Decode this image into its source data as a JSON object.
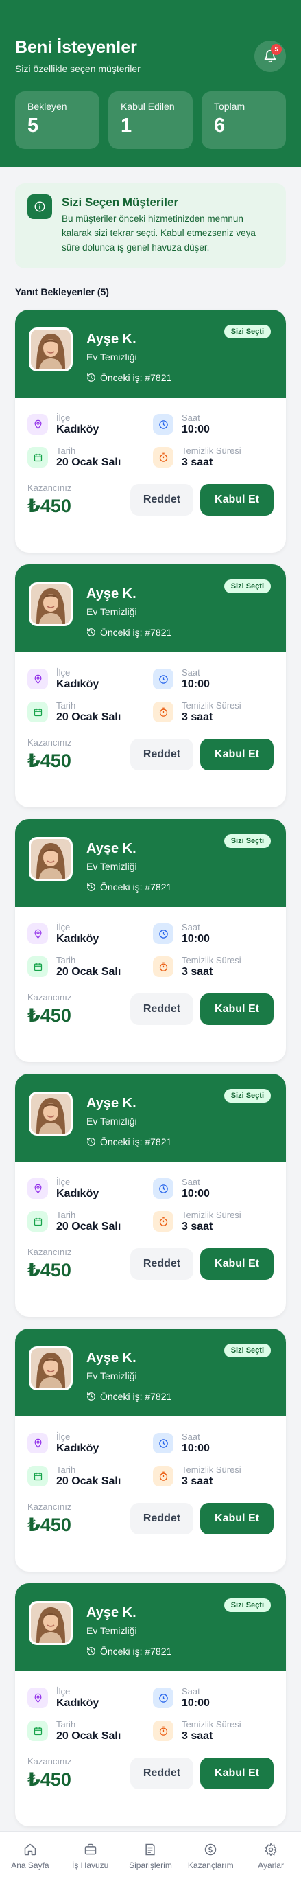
{
  "header": {
    "title": "Beni İsteyenler",
    "subtitle": "Sizi özellikle seçen müşteriler",
    "notification_count": "5",
    "stats": [
      {
        "label": "Bekleyen",
        "value": "5"
      },
      {
        "label": "Kabul Edilen",
        "value": "1"
      },
      {
        "label": "Toplam",
        "value": "6"
      }
    ]
  },
  "info": {
    "title": "Sizi Seçen Müşteriler",
    "text": "Bu müşteriler önceki hizmetinizden memnun kalarak sizi tekrar seçti. Kabul etmezseniz veya süre dolunca iş genel havuza düşer."
  },
  "section_title": "Yanıt Bekleyenler (5)",
  "labels": {
    "district": "İlçe",
    "time": "Saat",
    "date": "Tarih",
    "duration": "Temizlik Süresi",
    "earnings": "Kazancınız",
    "reject": "Reddet",
    "accept": "Kabul Et",
    "badge": "Sizi Seçti"
  },
  "requests": [
    {
      "name": "Ayşe K.",
      "service": "Ev Temizliği",
      "previous_job": "Önceki iş: #7821",
      "district": "Kadıköy",
      "time": "10:00",
      "date": "20 Ocak Salı",
      "duration": "3 saat",
      "earnings": "₺450"
    },
    {
      "name": "Ayşe K.",
      "service": "Ev Temizliği",
      "previous_job": "Önceki iş: #7821",
      "district": "Kadıköy",
      "time": "10:00",
      "date": "20 Ocak Salı",
      "duration": "3 saat",
      "earnings": "₺450"
    },
    {
      "name": "Ayşe K.",
      "service": "Ev Temizliği",
      "previous_job": "Önceki iş: #7821",
      "district": "Kadıköy",
      "time": "10:00",
      "date": "20 Ocak Salı",
      "duration": "3 saat",
      "earnings": "₺450"
    },
    {
      "name": "Ayşe K.",
      "service": "Ev Temizliği",
      "previous_job": "Önceki iş: #7821",
      "district": "Kadıköy",
      "time": "10:00",
      "date": "20 Ocak Salı",
      "duration": "3 saat",
      "earnings": "₺450"
    },
    {
      "name": "Ayşe K.",
      "service": "Ev Temizliği",
      "previous_job": "Önceki iş: #7821",
      "district": "Kadıköy",
      "time": "10:00",
      "date": "20 Ocak Salı",
      "duration": "3 saat",
      "earnings": "₺450"
    },
    {
      "name": "Ayşe K.",
      "service": "Ev Temizliği",
      "previous_job": "Önceki iş: #7821",
      "district": "Kadıköy",
      "time": "10:00",
      "date": "20 Ocak Salı",
      "duration": "3 saat",
      "earnings": "₺450"
    }
  ],
  "nav": [
    {
      "label": "Ana Sayfa",
      "icon": "home-icon"
    },
    {
      "label": "İş Havuzu",
      "icon": "briefcase-icon"
    },
    {
      "label": "Siparişlerim",
      "icon": "receipt-icon"
    },
    {
      "label": "Kazançlarım",
      "icon": "money-icon"
    },
    {
      "label": "Ayarlar",
      "icon": "gear-icon"
    }
  ],
  "colors": {
    "primary": "#1a7a46",
    "light_green": "#e8f5ec",
    "badge": "#ef4444"
  }
}
